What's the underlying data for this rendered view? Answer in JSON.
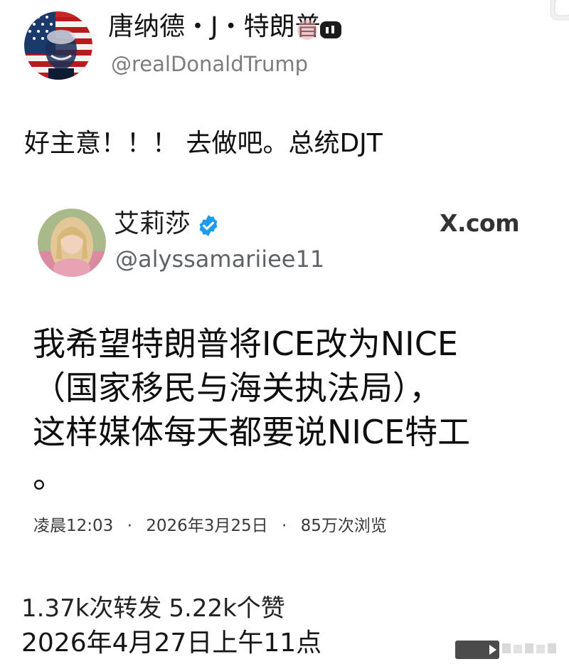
{
  "post": {
    "display_name": "唐纳德・J・特朗普",
    "handle": "@realDonaldTrump",
    "text": "好主意！！！ 去做吧。总统DJT",
    "avatar_icon": "flag-portrait-avatar",
    "menu_icon": "more-menu-icon"
  },
  "quoted": {
    "display_name": "艾莉莎",
    "handle": "@alyssamariiee11",
    "verified_color": "#1d9bf0",
    "source_label": "X.com",
    "text_lines": [
      "我希望特朗普将ICE改为NICE",
      "（国家移民与海关执法局），",
      "这样媒体每天都要说NICE特工",
      "。"
    ],
    "meta": {
      "time": "凌晨12:03",
      "date": "2026年3月25日",
      "views": "85万次浏览",
      "separator": "·"
    }
  },
  "footer": {
    "reposts": "1.37k次转发",
    "likes": "5.22k个赞",
    "posted_at": "2026年4月27日上午11点"
  }
}
